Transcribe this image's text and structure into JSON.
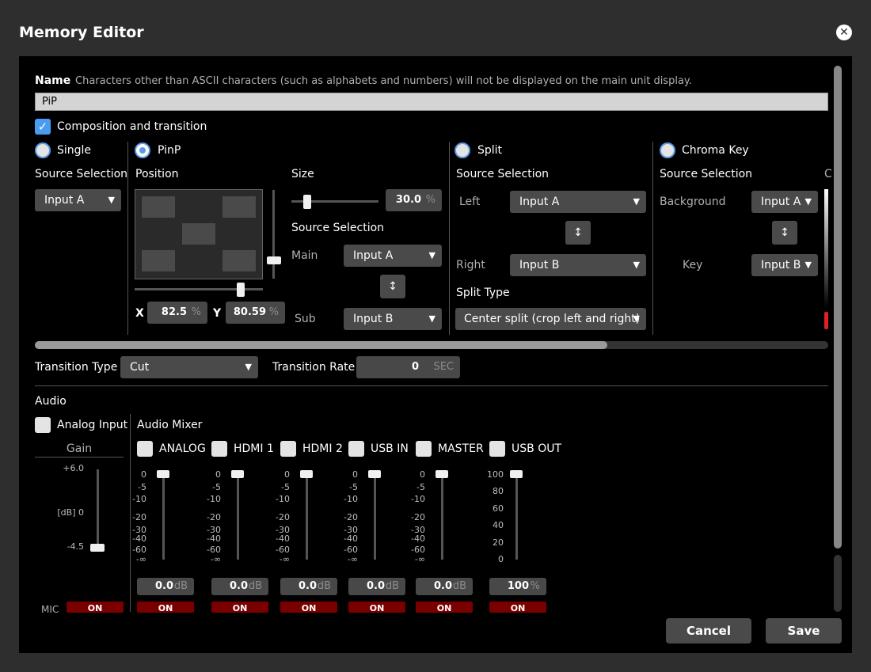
{
  "dialog": {
    "title": "Memory Editor",
    "close_icon": "close-icon"
  },
  "name": {
    "label": "Name",
    "hint": "Characters other than ASCII characters (such as alphabets and numbers) will not be displayed on the main unit display.",
    "value": "PiP"
  },
  "composition": {
    "label": "Composition and transition",
    "checked": true
  },
  "single": {
    "label": "Single",
    "source_label": "Source Selection",
    "source_value": "Input A"
  },
  "pinp": {
    "label": "PinP",
    "position_label": "Position",
    "size_label": "Size",
    "size_value": "30.0",
    "size_unit": "%",
    "size_fraction": 0.3,
    "x_label": "X",
    "x_value": "82.5",
    "x_unit": "%",
    "y_label": "Y",
    "y_value": "80.59",
    "y_unit": "%",
    "source_label": "Source Selection",
    "main_label": "Main",
    "main_value": "Input A",
    "sub_label": "Sub",
    "sub_value": "Input B",
    "swap_icon": "swap-vertical-icon"
  },
  "split": {
    "label": "Split",
    "source_label": "Source Selection",
    "left_label": "Left",
    "left_value": "Input A",
    "right_label": "Right",
    "right_value": "Input B",
    "type_label": "Split Type",
    "type_value": "Center split (crop left and right)"
  },
  "chroma": {
    "label": "Chroma Key",
    "source_label": "Source Selection",
    "background_label": "Background",
    "background_value": "Input A",
    "key_label": "Key",
    "key_value": "Input B",
    "next_label_partial": "C"
  },
  "transition": {
    "type_label": "Transition Type",
    "type_value": "Cut",
    "rate_label": "Transition Rate",
    "rate_value": "0",
    "rate_unit": "SEC"
  },
  "audio": {
    "section_label": "Audio",
    "analog_input_label": "Analog Input",
    "gain_label": "Gain",
    "gain_scale": [
      "+6.0",
      "[dB] 0",
      "-4.5"
    ],
    "gain_value_db": -4.5,
    "mic_label": "MIC",
    "on_label": "ON",
    "mixer_label": "Audio Mixer",
    "db_scale": [
      "0",
      "-5",
      "-10",
      "-20",
      "-30",
      "-40",
      "-60",
      "-∞"
    ],
    "pct_scale": [
      "100",
      "80",
      "60",
      "40",
      "20",
      "0"
    ],
    "channels": [
      {
        "name": "ANALOG",
        "value": "0.0",
        "unit": "dB",
        "on": "ON"
      },
      {
        "name": "HDMI 1",
        "value": "0.0",
        "unit": "dB",
        "on": "ON"
      },
      {
        "name": "HDMI 2",
        "value": "0.0",
        "unit": "dB",
        "on": "ON"
      },
      {
        "name": "USB IN",
        "value": "0.0",
        "unit": "dB",
        "on": "ON"
      },
      {
        "name": "MASTER",
        "value": "0.0",
        "unit": "dB",
        "on": "ON"
      },
      {
        "name": "USB OUT",
        "value": "100",
        "unit": "%",
        "on": "ON"
      }
    ]
  },
  "footer": {
    "cancel": "Cancel",
    "save": "Save"
  },
  "colors": {
    "accent": "#4a9cf0",
    "on_red": "#7a0000",
    "background": "#000000",
    "dialog": "#2e2e2e"
  }
}
